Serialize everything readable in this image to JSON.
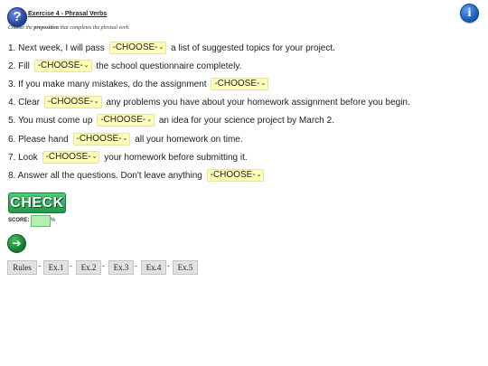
{
  "header": {
    "title": "Exercise 4 - Phrasal Verbs",
    "instruction_pre": "Choose the ",
    "instruction_bold": "preposition",
    "instruction_post": " that completes the phrasal verb.",
    "help_icon": "?",
    "info_icon": "i"
  },
  "dropdown_placeholder": "-CHOOSE-",
  "questions": [
    {
      "pre": "1. Next week, I will pass",
      "post": "a list of suggested topics for your project."
    },
    {
      "pre": "2. Fill",
      "post": "the school questionnaire completely."
    },
    {
      "pre": "3. If you make many mistakes, do the assignment",
      "post": ""
    },
    {
      "pre": "4. Clear",
      "post": "any problems you have about your homework assignment before you begin."
    },
    {
      "pre": "5. You must come up",
      "post": "an idea for your science project by March 2."
    },
    {
      "pre": "6. Please hand",
      "post": "all your homework on time."
    },
    {
      "pre": "7. Look",
      "post": "your homework before submitting it."
    },
    {
      "pre": "8. Answer all the questions. Don't leave anything",
      "post": ""
    }
  ],
  "check_label": "CHECK",
  "score_label": "SCORE:",
  "score_value": "",
  "percent_sign": "%",
  "nav": {
    "items": [
      "Rules",
      "Ex.1",
      "Ex.2",
      "Ex.3",
      "Ex.4",
      "Ex.5"
    ],
    "separator": "-"
  },
  "colors": {
    "dropdown_bg": "#ffffb8",
    "check_green": "#2fb35c",
    "score_bg": "#b4f0b4",
    "icon_blue": "#1f3f9a"
  }
}
